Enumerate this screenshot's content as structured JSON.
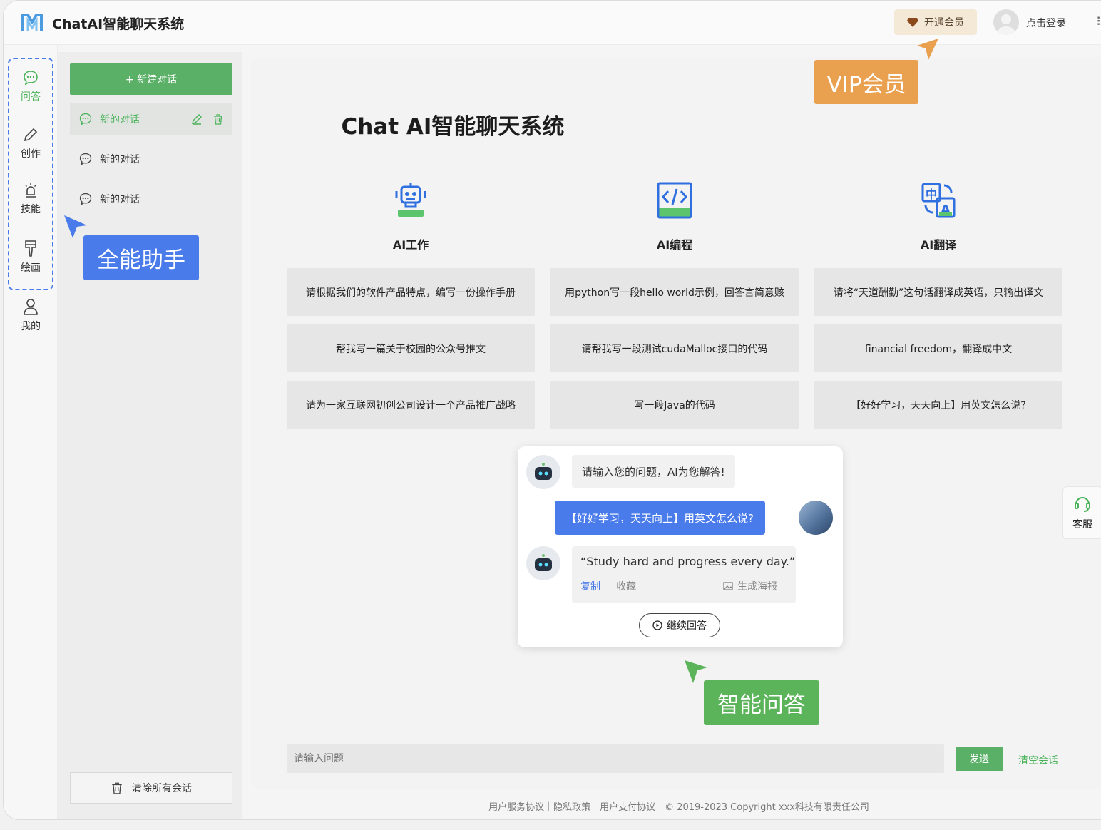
{
  "header": {
    "app_title": "ChatAI智能聊天系统",
    "vip_label": "开通会员",
    "login_label": "点击登录",
    "logo_icon": "m-logo-icon"
  },
  "nav": {
    "items": [
      {
        "label": "问答",
        "icon": "chat-bubble-icon",
        "active": true
      },
      {
        "label": "创作",
        "icon": "pencil-icon",
        "active": false
      },
      {
        "label": "技能",
        "icon": "lamp-icon",
        "active": false
      },
      {
        "label": "绘画",
        "icon": "brush-icon",
        "active": false
      },
      {
        "label": "我的",
        "icon": "user-icon",
        "active": false
      }
    ]
  },
  "sidebar": {
    "new_chat_label": "+ 新建对话",
    "conversations": [
      "新的对话",
      "新的对话",
      "新的对话"
    ],
    "clear_all_label": "清除所有会话"
  },
  "main": {
    "title": "Chat AI智能聊天系统",
    "categories": [
      {
        "label": "AI工作",
        "icon": "robot-icon",
        "prompts": [
          "请根据我们的软件产品特点，编写一份操作手册",
          "帮我写一篇关于校园的公众号推文",
          "请为一家互联网初创公司设计一个产品推广战略"
        ]
      },
      {
        "label": "AI编程",
        "icon": "code-icon",
        "prompts": [
          "用python写一段hello world示例，回答言简意赅",
          "请帮我写一段测试cudaMalloc接口的代码",
          "写一段Java的代码"
        ]
      },
      {
        "label": "AI翻译",
        "icon": "translate-icon",
        "prompts": [
          "请将“天道酬勤”这句话翻译成英语，只输出译文",
          "financial freedom，翻译成中文",
          "【好好学习，天天向上】用英文怎么说?"
        ]
      }
    ]
  },
  "chat_demo": {
    "ai_greeting": "请输入您的问题，AI为您解答!",
    "user_message": "【好好学习，天天向上】用英文怎么说?",
    "ai_answer": "“Study hard and progress every day.”",
    "copy_label": "复制",
    "favorite_label": "收藏",
    "poster_label": "生成海报",
    "continue_label": "继续回答"
  },
  "input": {
    "placeholder": "请输入问题",
    "send_label": "发送",
    "clear_label": "清空会话"
  },
  "service_label": "客服",
  "footer": "用户服务协议｜隐私政策｜用户支付协议｜© 2019-2023 Copyright xxx科技有限责任公司",
  "callouts": {
    "vip": "VIP会员",
    "all_in_one": "全能助手",
    "smart_qa": "智能问答"
  },
  "colors": {
    "accent_green": "#5bb068",
    "accent_blue": "#4a7bea",
    "accent_orange": "#e9a04f"
  }
}
